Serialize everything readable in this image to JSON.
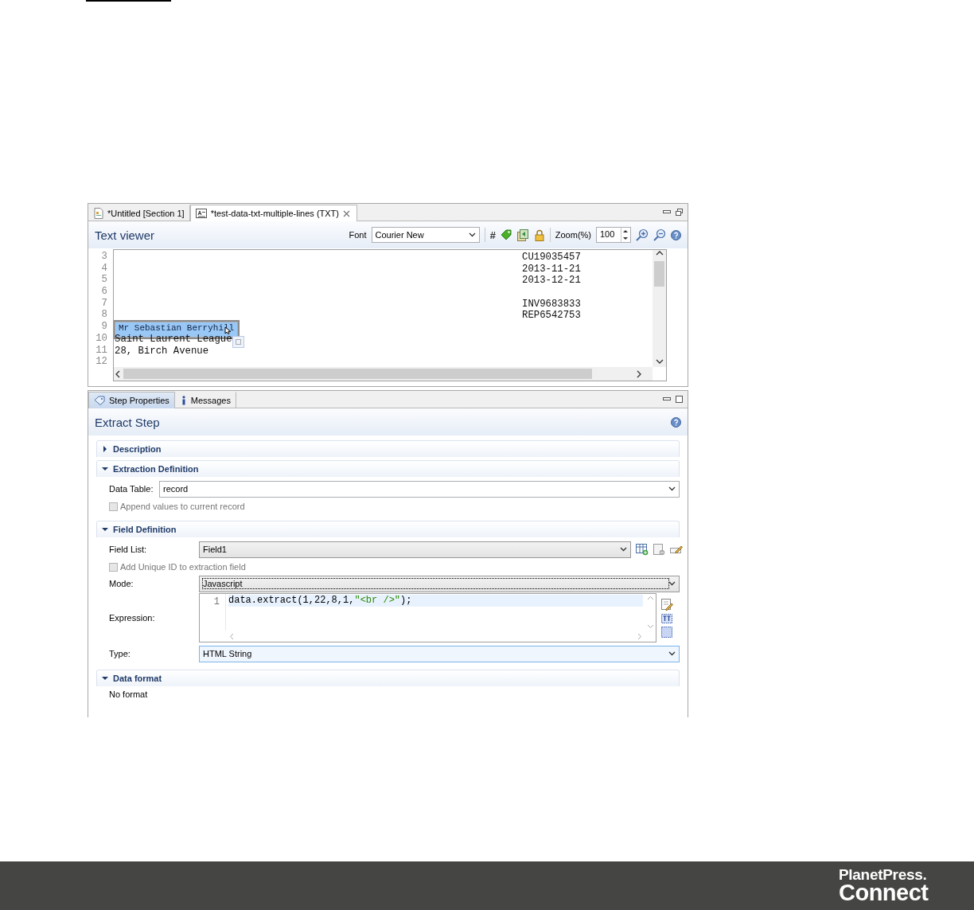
{
  "editor_tabs": [
    {
      "label": "*Untitled [Section 1]",
      "selected": false,
      "kind": "template"
    },
    {
      "label": "*test-data-txt-multiple-lines (TXT)",
      "selected": true,
      "kind": "text"
    }
  ],
  "text_viewer": {
    "title": "Text viewer",
    "font_label": "Font",
    "font": "Courier New",
    "line_number_glyph": "#",
    "zoom_label": "Zoom(%)",
    "zoom": "100",
    "lines": [
      {
        "number": "3",
        "right": "CU19035457",
        "selected": false
      },
      {
        "number": "4",
        "right": "2013-11-21",
        "selected": false
      },
      {
        "number": "5",
        "right": "2013-12-21",
        "selected": false
      },
      {
        "number": "6",
        "selected": false
      },
      {
        "number": "7",
        "right": "INV9683833",
        "selected": false
      },
      {
        "number": "8",
        "right": "REP6542753",
        "selected": false
      },
      {
        "number": "9",
        "left": "Mr Sebastian Berryhill",
        "selected": true
      },
      {
        "number": "10",
        "left": "Saint Laurent League",
        "selected": false
      },
      {
        "number": "11",
        "left": "28, Birch Avenue",
        "selected": false
      },
      {
        "number": "12",
        "selected": false
      }
    ]
  },
  "panel_tabs": [
    {
      "label": "Step Properties",
      "selected": true,
      "kind": "properties"
    },
    {
      "label": "Messages",
      "selected": false,
      "kind": "info"
    }
  ],
  "step": {
    "title": "Extract Step",
    "sections": [
      {
        "title": "Description",
        "expanded": false
      },
      {
        "title": "Extraction Definition",
        "expanded": true,
        "kind": "extraction",
        "data_table_label": "Data Table:",
        "data_table": "record",
        "append_label": "Append values to current record",
        "append_checked": false,
        "append_disabled": true
      },
      {
        "title": "Field Definition",
        "expanded": true,
        "kind": "field",
        "field_list_label": "Field List:",
        "field_list": "Field1",
        "unique_id_label": "Add Unique ID to extraction field",
        "unique_id_checked": false,
        "unique_id_disabled": true,
        "mode_label": "Mode:",
        "mode": "Javascript",
        "expression_label": "Expression:",
        "expression_line_number": "1",
        "expression_tokens": [
          {
            "text": "data.extract(1,22,8,1,",
            "kind": "plain"
          },
          {
            "text": "\"<br />\"",
            "kind": "string"
          },
          {
            "text": ");",
            "kind": "plain"
          }
        ],
        "type_label": "Type:",
        "type": "HTML String"
      },
      {
        "title": "Data format",
        "expanded": true,
        "kind": "format",
        "text": "No format"
      }
    ]
  },
  "footer": {
    "logo_top": "PlanetPress.",
    "logo_bottom": "Connect"
  }
}
